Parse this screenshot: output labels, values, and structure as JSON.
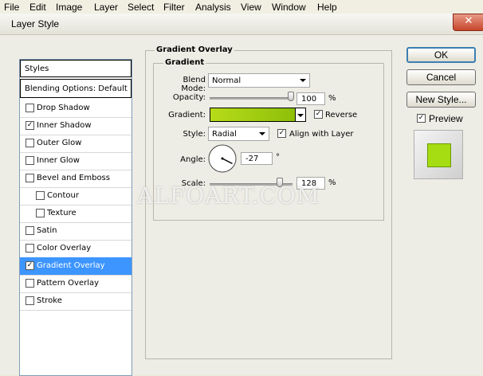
{
  "menubar": {
    "items": [
      "File",
      "Edit",
      "Image",
      "Layer",
      "Select",
      "Filter",
      "Analysis",
      "View",
      "Window",
      "Help"
    ]
  },
  "dialog": {
    "title": "Layer Style",
    "close_glyph": "✕",
    "styles_header": "Styles",
    "blending_options": "Blending Options: Default",
    "effects": [
      {
        "label": "Drop Shadow",
        "checked": false
      },
      {
        "label": "Inner Shadow",
        "checked": true
      },
      {
        "label": "Outer Glow",
        "checked": false
      },
      {
        "label": "Inner Glow",
        "checked": false
      },
      {
        "label": "Bevel and Emboss",
        "checked": false
      },
      {
        "label": "Contour",
        "checked": false
      },
      {
        "label": "Texture",
        "checked": false
      },
      {
        "label": "Satin",
        "checked": false
      },
      {
        "label": "Color Overlay",
        "checked": false
      },
      {
        "label": "Gradient Overlay",
        "checked": true
      },
      {
        "label": "Pattern Overlay",
        "checked": false
      },
      {
        "label": "Stroke",
        "checked": false
      }
    ],
    "check_glyph": "✓"
  },
  "gradient_overlay": {
    "section_title": "Gradient Overlay",
    "subsection_title": "Gradient",
    "blend_mode_label": "Blend Mode:",
    "blend_mode_value": "Normal",
    "opacity_label": "Opacity:",
    "opacity_value": "100",
    "opacity_unit": "%",
    "opacity_fraction": 1.0,
    "gradient_label": "Gradient:",
    "gradient_colors": [
      "#b6dc19",
      "#8fbf0a"
    ],
    "reverse_label": "Reverse",
    "reverse_checked": true,
    "style_label": "Style:",
    "style_value": "Radial",
    "align_label": "Align with Layer",
    "align_checked": true,
    "angle_label": "Angle:",
    "angle_value": "-27",
    "angle_unit": "°",
    "angle_degrees": -27,
    "scale_label": "Scale:",
    "scale_value": "128",
    "scale_unit": "%",
    "scale_fraction": 0.85
  },
  "buttons": {
    "ok": "OK",
    "cancel": "Cancel",
    "new_style": "New Style...",
    "preview_label": "Preview",
    "preview_checked": true
  },
  "preview_color": "#a6dc12",
  "watermark": "ALFOART.COM"
}
